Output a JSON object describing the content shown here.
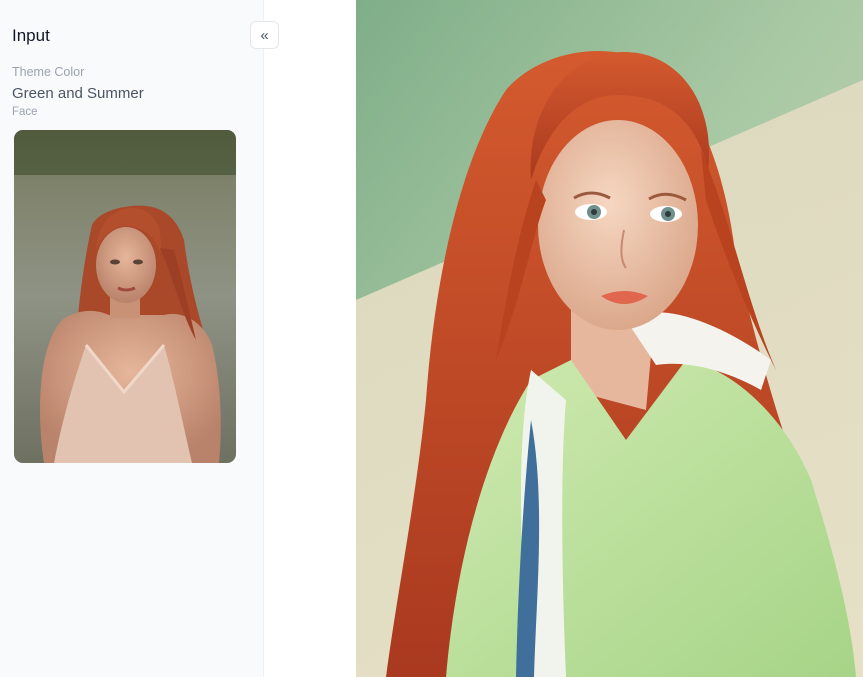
{
  "panel": {
    "title": "Input",
    "collapse_glyph": "«",
    "theme_label": "Theme Color",
    "theme_value": "Green and Summer",
    "face_label": "Face"
  },
  "icons": {
    "collapse": "double-chevron-left-icon"
  },
  "colors": {
    "sidebar_bg": "#f8fafc",
    "hair": "#c4502a",
    "coat": "#b7de9a",
    "backdrop": "#a7c9a3"
  }
}
